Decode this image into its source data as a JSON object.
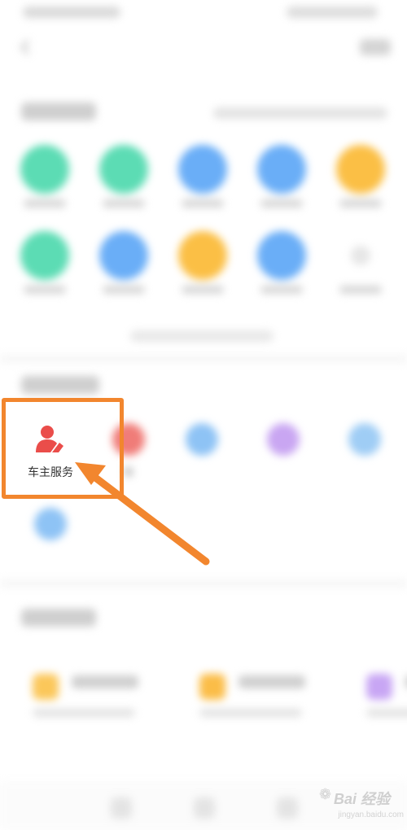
{
  "status_bar": {
    "left_text": "",
    "right_text": ""
  },
  "header": {
    "back_icon": "back-arrow-icon",
    "right_button": ""
  },
  "section_tools": {
    "title": "",
    "links_text": "",
    "items": [
      {
        "label": "",
        "color": "#5cdcb4"
      },
      {
        "label": "",
        "color": "#5cdcb4"
      },
      {
        "label": "",
        "color": "#6aaef7"
      },
      {
        "label": "",
        "color": "#6aaef7"
      },
      {
        "label": "",
        "color": "#fbbf45"
      },
      {
        "label": "",
        "color": "#5cdcb4"
      },
      {
        "label": "",
        "color": "#6aaef7"
      },
      {
        "label": "",
        "color": "#fbbf45"
      },
      {
        "label": "",
        "color": "#6aaef7"
      },
      {
        "label": "",
        "color": "#eeeeee"
      }
    ],
    "footer_text": ""
  },
  "section_services": {
    "title": "",
    "items": [
      {
        "label": "车主服务",
        "color": "#ea4d4a",
        "icon": "car-owner-person-icon"
      },
      {
        "label": "车",
        "color": "#f07c78",
        "icon": "car-icon"
      },
      {
        "label": "",
        "color": "#8ec3f5",
        "icon": "service-icon"
      },
      {
        "label": "",
        "color": "#c9a6f2",
        "icon": "cloud-icon"
      },
      {
        "label": "",
        "color": "#9fcdf5",
        "icon": "service-icon"
      },
      {
        "label": "",
        "color": "#8ec3f5",
        "icon": "people-icon"
      }
    ]
  },
  "section_cards": {
    "title": "",
    "cards": [
      {
        "title": "",
        "subtitle": "",
        "color": "#fbc75a"
      },
      {
        "title": "",
        "subtitle": "",
        "color": "#fbbd48"
      },
      {
        "title": "",
        "subtitle": "",
        "color": "#c8a6f4"
      }
    ]
  },
  "annotation": {
    "accent": "#f2862e"
  },
  "watermark": {
    "main": "Bai 经验",
    "sub": "jingyan.baidu.com"
  }
}
